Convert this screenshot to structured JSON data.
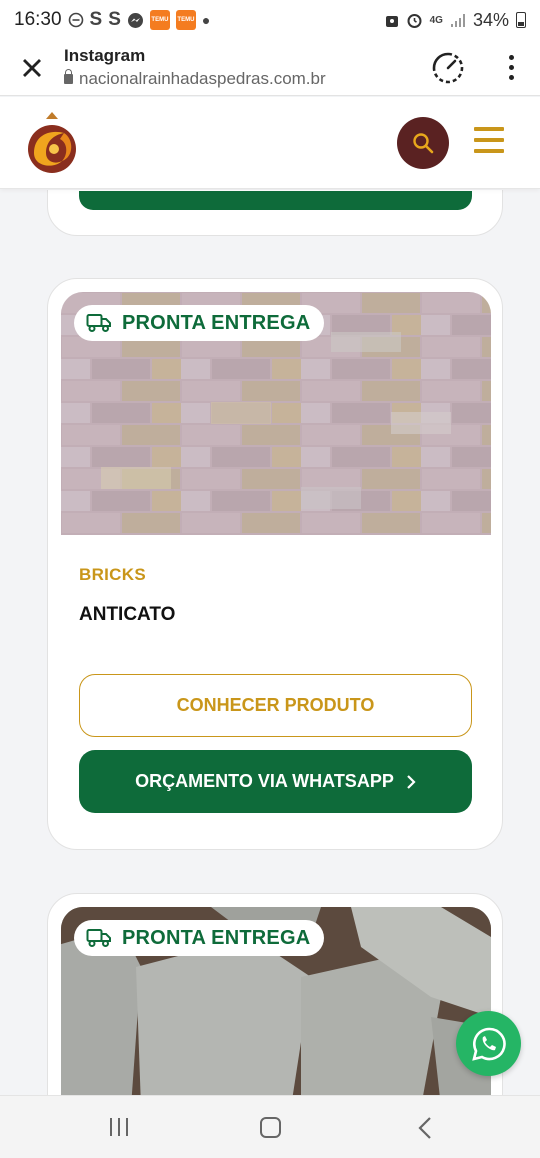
{
  "status_bar": {
    "time": "16:30",
    "app_s1": "S",
    "app_s2": "S",
    "temu_label": "TEMU",
    "network": "4G",
    "battery": "34%"
  },
  "browser": {
    "title": "Instagram",
    "url": "nacionalrainhadaspedras.com.br"
  },
  "product_card": {
    "badge": "PRONTA ENTREGA",
    "category": "BRICKS",
    "name": "ANTICATO",
    "primary_button": "CONHECER PRODUTO",
    "secondary_button": "ORÇAMENTO VIA WHATSAPP"
  },
  "next_card": {
    "badge": "PRONTA ENTREGA"
  },
  "colors": {
    "brand_green": "#0e6b3a",
    "brand_gold": "#c9961a",
    "brand_maroon": "#5a2222",
    "whatsapp_green": "#25b565"
  }
}
